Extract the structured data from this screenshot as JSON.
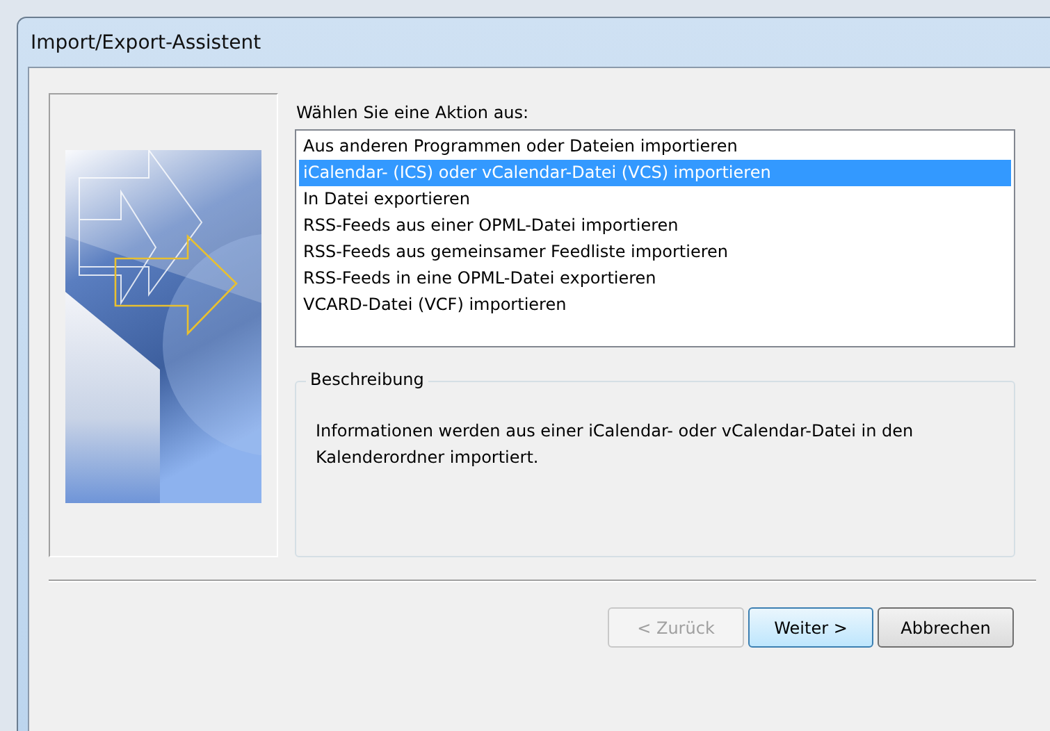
{
  "window": {
    "title": "Import/Export-Assistent"
  },
  "action_list": {
    "label": "Wählen Sie eine Aktion aus:",
    "items": [
      {
        "label": "Aus anderen Programmen oder Dateien importieren",
        "selected": false
      },
      {
        "label": "iCalendar- (ICS) oder vCalendar-Datei (VCS) importieren",
        "selected": true
      },
      {
        "label": "In Datei exportieren",
        "selected": false
      },
      {
        "label": "RSS-Feeds aus einer OPML-Datei importieren",
        "selected": false
      },
      {
        "label": "RSS-Feeds aus gemeinsamer Feedliste importieren",
        "selected": false
      },
      {
        "label": "RSS-Feeds in eine OPML-Datei exportieren",
        "selected": false
      },
      {
        "label": "VCARD-Datei (VCF) importieren",
        "selected": false
      }
    ]
  },
  "description": {
    "title": "Beschreibung",
    "text": "Informationen werden aus einer iCalendar- oder vCalendar-Datei in den Kalenderordner importiert."
  },
  "buttons": [
    {
      "label": "< Zurück",
      "disabled": true,
      "default": false
    },
    {
      "label": "Weiter >",
      "disabled": false,
      "default": true
    },
    {
      "label": "Abbrechen",
      "disabled": false,
      "default": false
    }
  ]
}
